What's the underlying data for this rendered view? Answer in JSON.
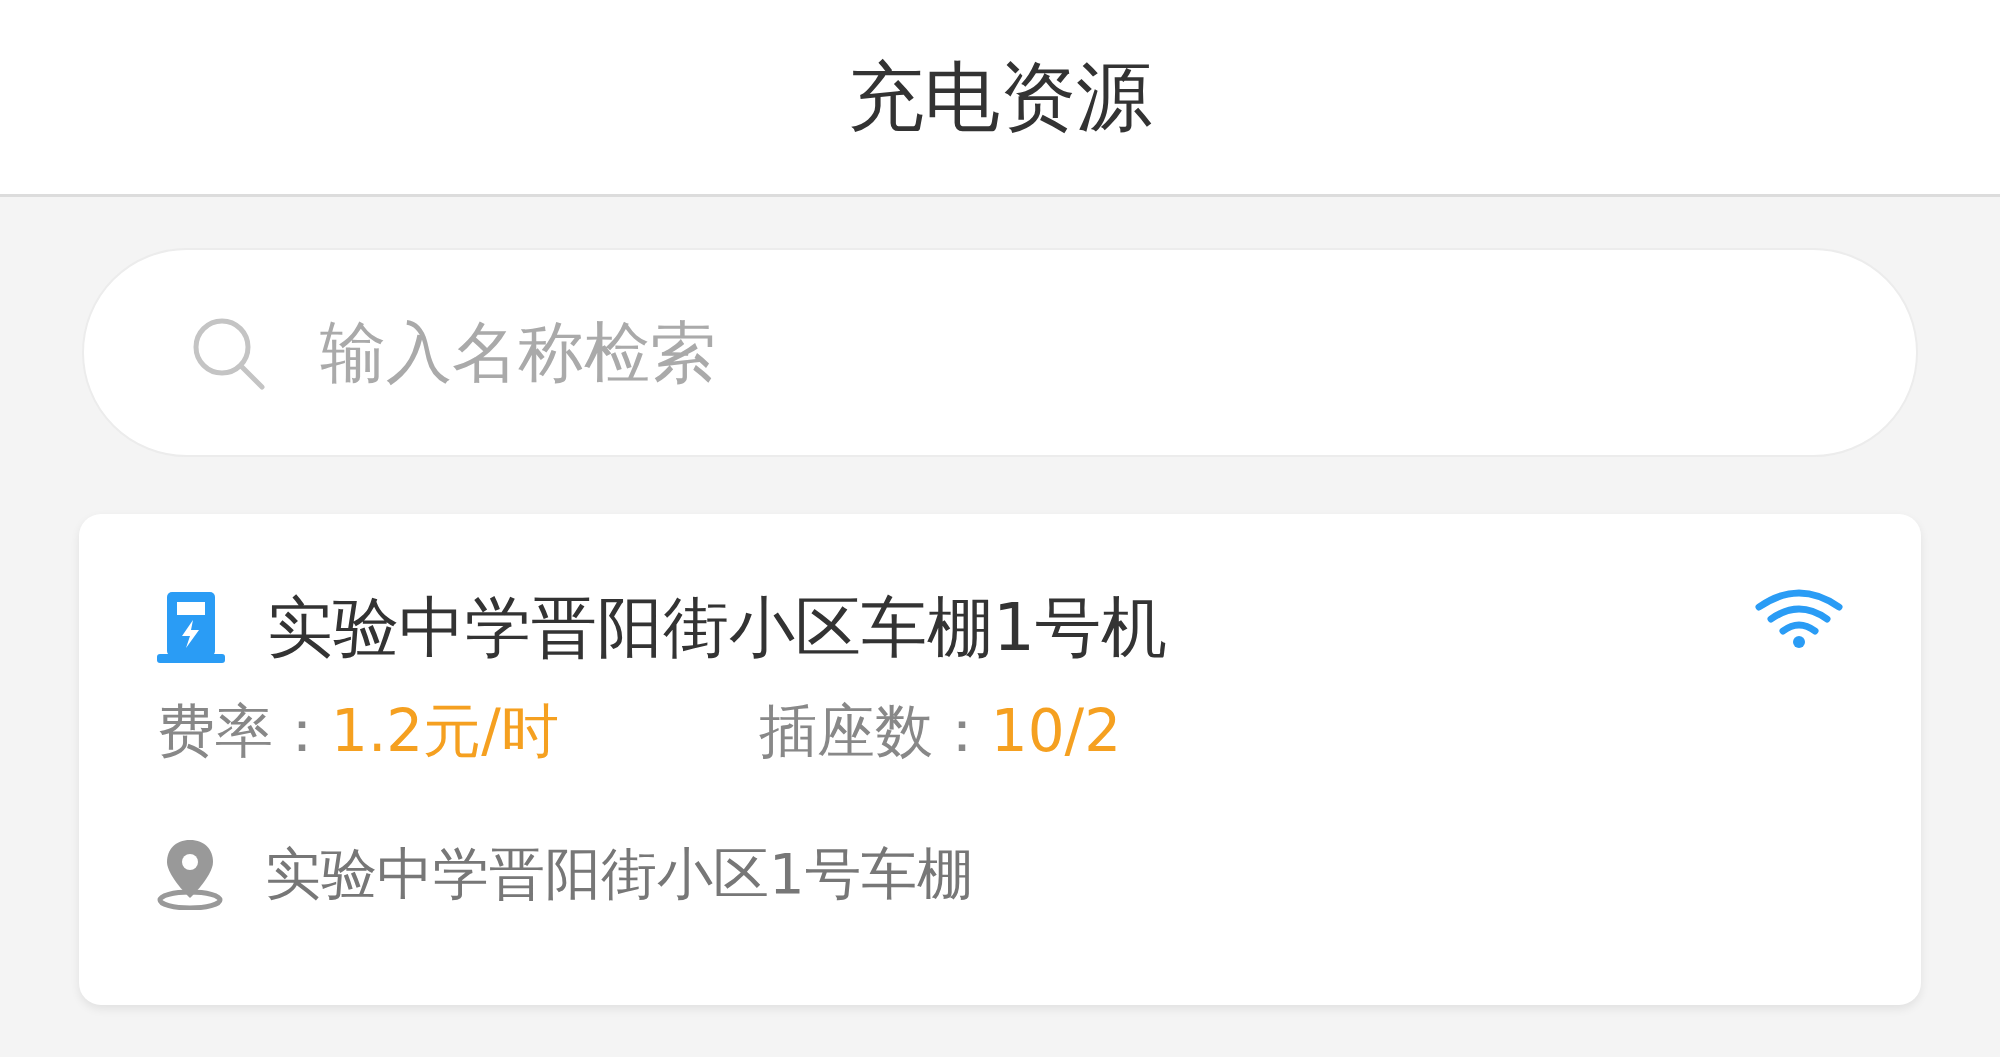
{
  "header": {
    "title": "充电资源"
  },
  "search": {
    "placeholder": "输入名称检索"
  },
  "stations": [
    {
      "name": "实验中学晋阳街小区车棚1号机",
      "rate_label": "费率：",
      "rate": "1.2元/时",
      "sockets_label": "插座数：",
      "sockets": "10/2",
      "address": "实验中学晋阳街小区1号车棚"
    }
  ]
}
